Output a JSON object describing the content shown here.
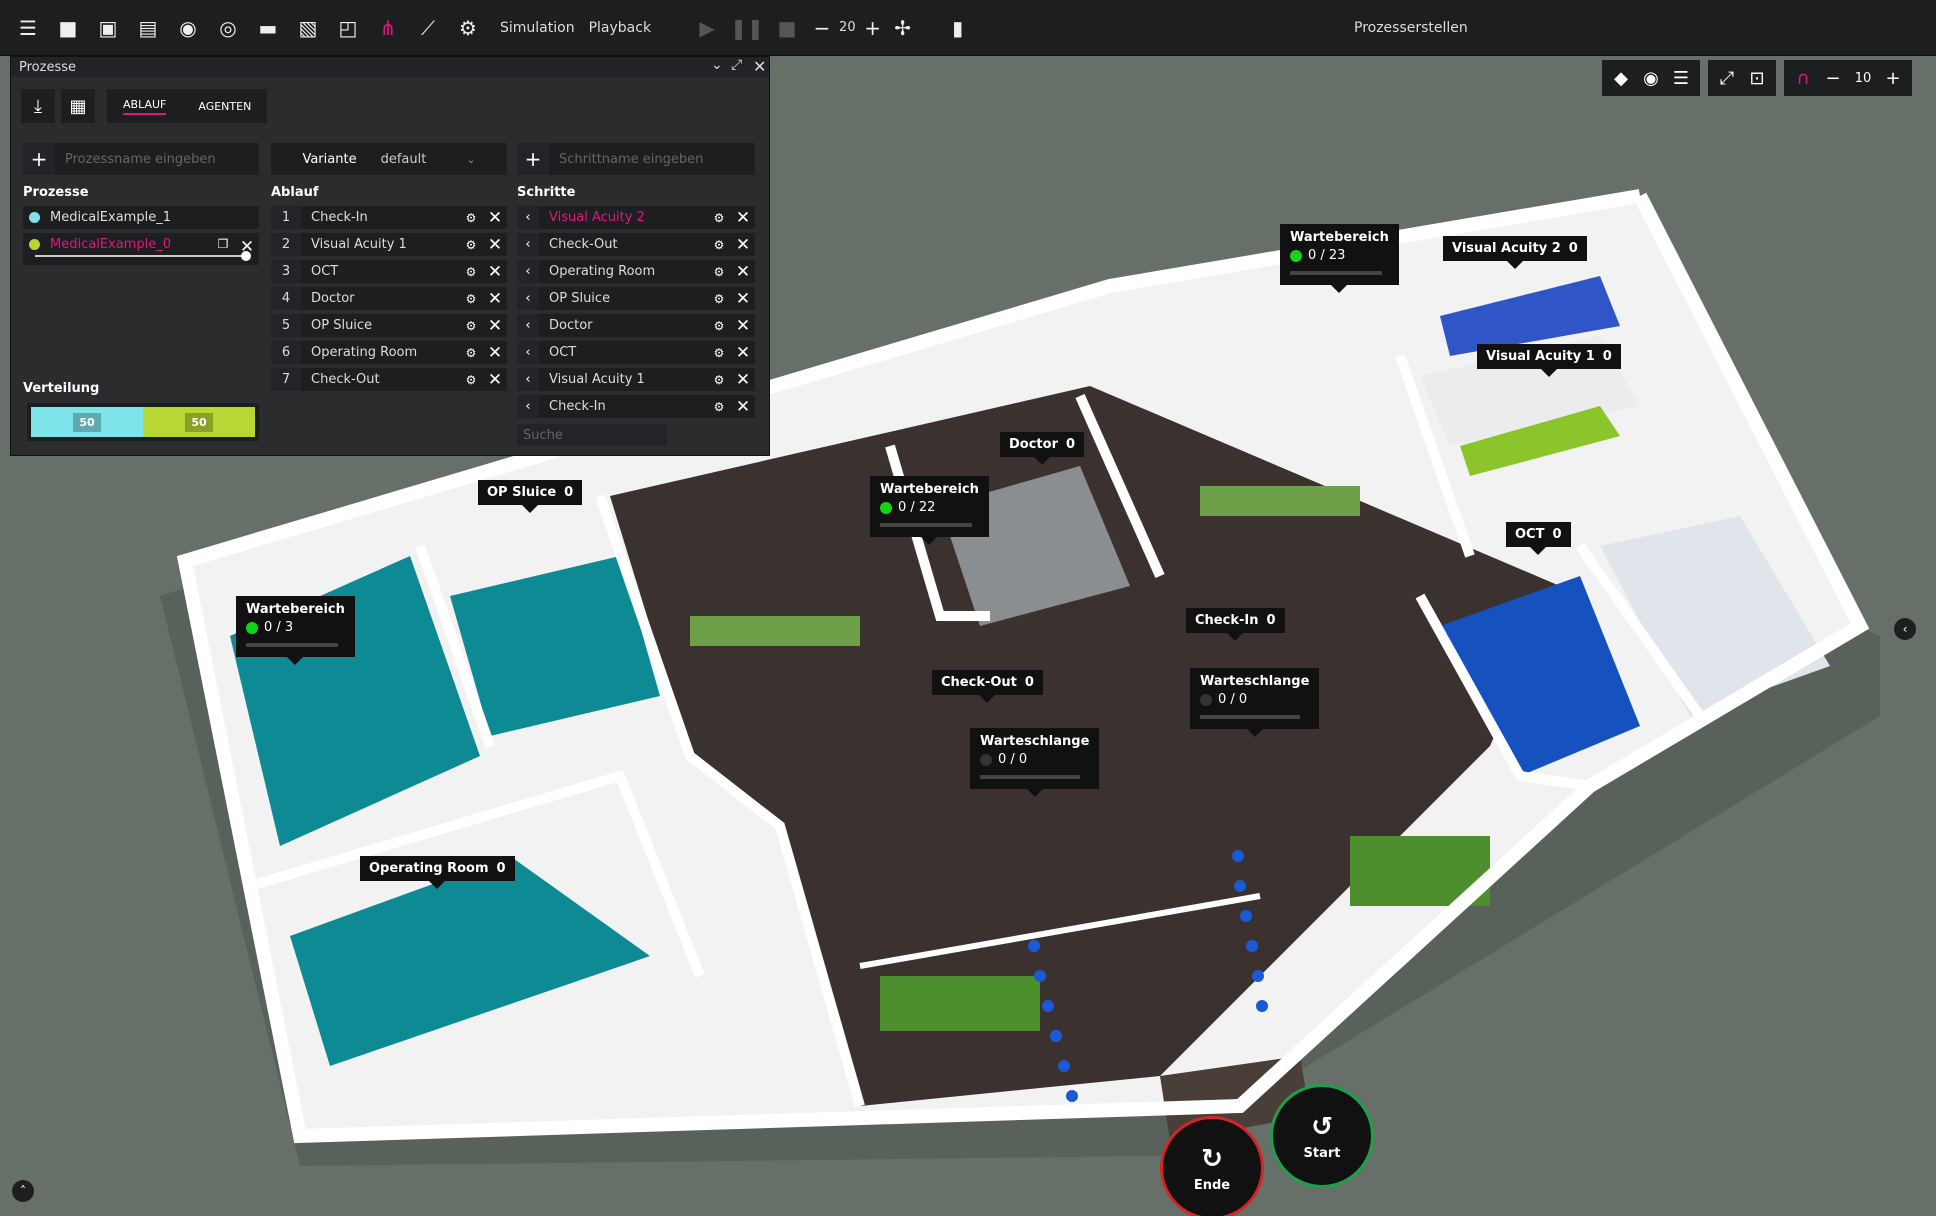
{
  "app": {
    "title": "Prozesserstellen"
  },
  "toolbar": {
    "simulation": "Simulation",
    "playback": "Playback",
    "speed": "20"
  },
  "panel": {
    "title": "Prozesse",
    "tabs": [
      {
        "label": "ABLAUF",
        "active": true
      },
      {
        "label": "AGENTEN",
        "active": false
      }
    ],
    "process_input_placeholder": "Prozessname eingeben",
    "variant_label": "Variante",
    "variant_value": "default",
    "step_input_placeholder": "Schrittname eingeben",
    "processes_header": "Prozesse",
    "processes": [
      {
        "name": "MedicalExample_1",
        "color": "#7fe3ea"
      },
      {
        "name": "MedicalExample_0",
        "color": "#b8d634"
      }
    ],
    "flow_header": "Ablauf",
    "flow": [
      {
        "num": "1",
        "label": "Check-In"
      },
      {
        "num": "2",
        "label": "Visual Acuity 1"
      },
      {
        "num": "3",
        "label": "OCT"
      },
      {
        "num": "4",
        "label": "Doctor"
      },
      {
        "num": "5",
        "label": "OP Sluice"
      },
      {
        "num": "6",
        "label": "Operating Room"
      },
      {
        "num": "7",
        "label": "Check-Out"
      }
    ],
    "steps_header": "Schritte",
    "steps": [
      {
        "label": "Visual Acuity 2"
      },
      {
        "label": "Check-Out"
      },
      {
        "label": "Operating Room"
      },
      {
        "label": "OP Sluice"
      },
      {
        "label": "Doctor"
      },
      {
        "label": "OCT"
      },
      {
        "label": "Visual Acuity 1"
      },
      {
        "label": "Check-In"
      }
    ],
    "search_placeholder": "Suche",
    "distribution_header": "Verteilung",
    "distribution": [
      {
        "value": "50",
        "color": "#7fe3ea"
      },
      {
        "value": "50",
        "color": "#b8d634"
      }
    ]
  },
  "view_tools": {
    "zoom": "10"
  },
  "rooms": [
    {
      "name": "OP Sluice",
      "count": "0"
    },
    {
      "name": "Doctor",
      "count": "0"
    },
    {
      "name": "Visual Acuity 2",
      "count": "0"
    },
    {
      "name": "Visual Acuity 1",
      "count": "0"
    },
    {
      "name": "OCT",
      "count": "0"
    },
    {
      "name": "Check-In",
      "count": "0"
    },
    {
      "name": "Check-Out",
      "count": "0"
    },
    {
      "name": "Operating Room",
      "count": "0"
    }
  ],
  "waiting": [
    {
      "name": "Wartebereich",
      "value": "0 / 3",
      "dot": "#17d317"
    },
    {
      "name": "Wartebereich",
      "value": "0 / 22",
      "dot": "#17d317"
    },
    {
      "name": "Wartebereich",
      "value": "0 / 23",
      "dot": "#17d317"
    },
    {
      "name": "Warteschlange",
      "value": "0 / 0",
      "dot": "#333333"
    },
    {
      "name": "Warteschlange",
      "value": "0 / 0",
      "dot": "#333333"
    }
  ],
  "controls": {
    "end": "Ende",
    "start": "Start"
  }
}
